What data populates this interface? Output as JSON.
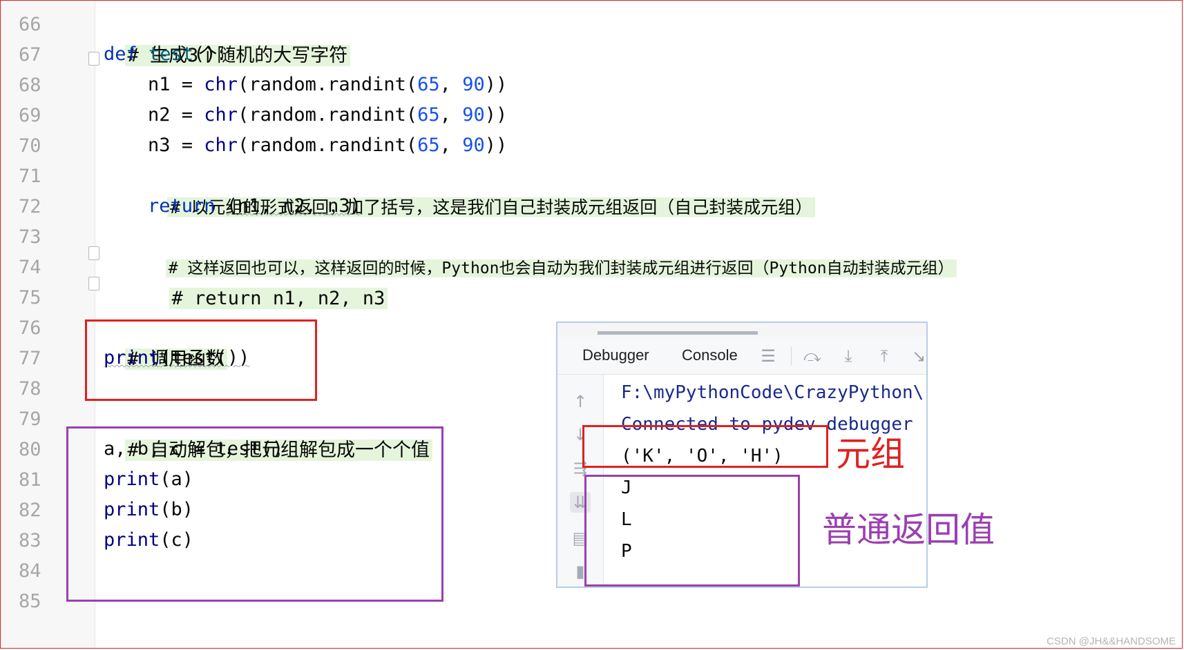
{
  "editor": {
    "line_numbers": [
      "66",
      "67",
      "68",
      "69",
      "70",
      "71",
      "72",
      "73",
      "74",
      "75",
      "76",
      "77",
      "78",
      "79",
      "80",
      "81",
      "82",
      "83",
      "84",
      "85"
    ],
    "lines": {
      "l66": "# 生成3个随机的大写字符",
      "l67_def": "def ",
      "l67_name": "test",
      "l67_rest": "():",
      "l68_var": "n1 = ",
      "l69_var": "n2 = ",
      "l70_var": "n3 = ",
      "chr": "chr",
      "call_open": "(random.randint(",
      "num_65": "65",
      "comma": ", ",
      "num_90": "90",
      "call_close": "))",
      "l71": "# 以元组的形式返回，加了括号，这是我们自己封装成元组返回（自己封装成元组）",
      "l72_kw": "return ",
      "l72_rest": "(n1, n2, n3)",
      "l73": "# 这样返回也可以，这样返回的时候，Python也会自动为我们封装成元组进行返回（Python自动封装成元组）",
      "l74": "# return n1, n2, n3",
      "l76": "# 调用函数",
      "l77_print": "print",
      "l77_rest": "(test())",
      "l79": "# 自动解包，把元组解包成一个个值",
      "l80": "a, b, c = test()",
      "print": "print",
      "l81_arg": "(a)",
      "l82_arg": "(b)",
      "l83_arg": "(c)"
    }
  },
  "console": {
    "tabs": [
      "Debugger",
      "Console"
    ],
    "active_tab": "Console",
    "toolbar_icons": [
      "menu-icon",
      "step-over-icon",
      "step-into-icon",
      "step-out-icon",
      "run-to-cursor-icon"
    ],
    "side_icons": [
      "up-arrow-icon",
      "down-arrow-icon",
      "soft-wrap-icon",
      "scroll-to-end-icon",
      "print-icon",
      "trash-icon"
    ],
    "output": [
      "F:\\myPythonCode\\CrazyPython\\",
      "Connected to pydev debugger",
      "('K', 'O', 'H')",
      "J",
      "L",
      "P"
    ]
  },
  "annotations": {
    "tuple_label": "元组",
    "normal_return_label": "普通返回值",
    "red": "#e02020",
    "purple": "#9b3fb0"
  },
  "watermark": "CSDN @JH&&HANDSOME"
}
